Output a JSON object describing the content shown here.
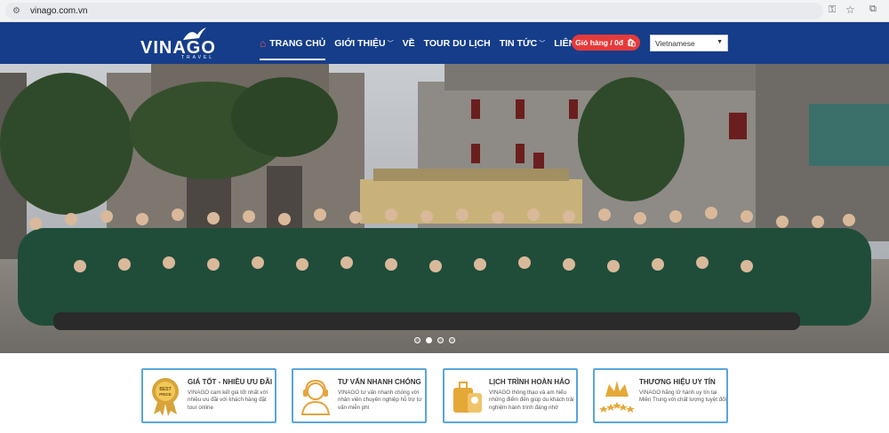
{
  "browser": {
    "url": "vinago.com.vn",
    "icons": [
      "tune-icon",
      "key-icon",
      "star-icon",
      "extension-icon"
    ]
  },
  "header": {
    "logo_text": "VINAGO",
    "logo_sub": "TRAVEL",
    "nav": [
      {
        "label": "TRANG CHỦ",
        "active": true,
        "icon": "home-icon"
      },
      {
        "label": "GIỚI THIỆU",
        "dropdown": true
      },
      {
        "label": "VỀ"
      },
      {
        "label": "TOUR DU LỊCH"
      },
      {
        "label": "TIN TỨC",
        "dropdown": true
      },
      {
        "label": "LIÊN HỆ"
      }
    ],
    "cart_label": "Giỏ hàng / 0đ",
    "language": "Vietnamese",
    "colors": {
      "header_bg": "#153d8a",
      "cart_bg": "#e63a3a",
      "feature_border": "#5ba5dc"
    }
  },
  "hero": {
    "slides": 4,
    "active_slide": 2
  },
  "features": [
    {
      "title": "GIÁ TỐT - NHIỀU ƯU ĐÃI",
      "desc": "VINAGO cam kết giá tốt nhất với nhiều ưu đãi với khách hàng đặt tour online",
      "icon": "best-price-badge-icon",
      "badge_text": "BEST PRICE"
    },
    {
      "title": "TƯ VẤN NHANH CHÓNG",
      "desc": "VINAGO tư vấn nhanh chóng với nhân viên chuyên nghiệp hỗ trợ tư vấn miễn phí",
      "icon": "support-agent-icon"
    },
    {
      "title": "LỊCH TRÌNH HOÀN HẢO",
      "desc": "VINAGO thông thạo và am hiểu những điểm đến giúp du khách trải nghiệm hành trình đáng nhớ",
      "icon": "luggage-icon"
    },
    {
      "title": "THƯƠNG HIỆU UY TÍN",
      "desc": "VINAGO hãng lữ hành uy tín tại Miền Trung với chất lượng tuyệt đối",
      "icon": "crown-stars-icon"
    }
  ]
}
